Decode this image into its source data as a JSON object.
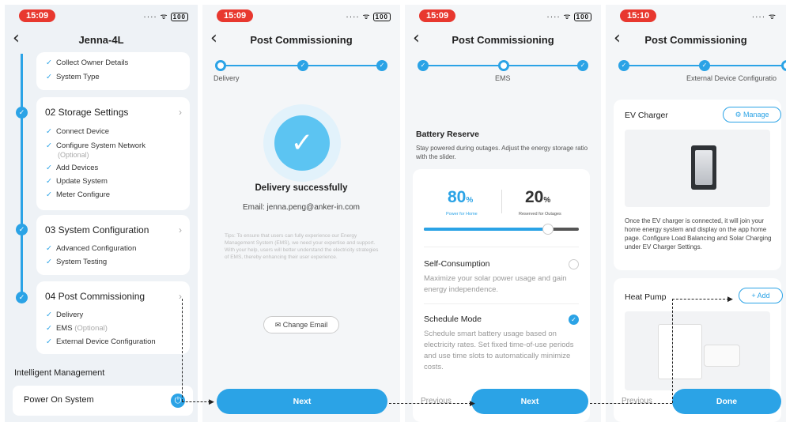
{
  "screen1": {
    "time": "15:09",
    "battery": "100",
    "title": "Jenna-4L",
    "card0_items": [
      "Collect Owner Details",
      "System Type"
    ],
    "card1": {
      "title": "02 Storage Settings",
      "items": [
        "Connect Device",
        "Configure System Network",
        "Add Devices",
        "Update System",
        "Meter Configure"
      ],
      "optional_note": "(Optional)"
    },
    "card2": {
      "title": "03 System Configuration",
      "items": [
        "Advanced Configuration",
        "System Testing"
      ]
    },
    "card3": {
      "title": "04 Post Commissioning",
      "items": [
        "Delivery",
        "EMS",
        "External Device Configuration"
      ],
      "ems_optional": "(Optional)"
    },
    "section_label": "Intelligent Management",
    "power_label": "Power On System"
  },
  "screen2": {
    "time": "15:09",
    "battery": "100",
    "title": "Post Commissioning",
    "step_label": "Delivery",
    "success_title": "Delivery successfully",
    "email": "Email: jenna.peng@anker-in.com",
    "tips": "Tips: To ensure that users can fully experience our Energy Management System (EMS), we need your expertise and support. With your help, users will better understand the electricity strategies of EMS, thereby enhancing their user experience.",
    "change_email": "Change Email",
    "next": "Next"
  },
  "screen3": {
    "time": "15:09",
    "battery": "100",
    "title": "Post Commissioning",
    "step_label": "EMS",
    "heading": "Battery Reserve",
    "desc": "Stay powered during outages. Adjust the energy storage ratio with the slider.",
    "home_pct": "80",
    "home_caption": "Power for Home",
    "reserve_pct": "20",
    "reserve_caption": "Reserved for Outages",
    "pct_sign": "%",
    "slider_fraction": 0.8,
    "option1_title": "Self-Consumption",
    "option1_desc": "Maximize your solar power usage and gain energy independence.",
    "option2_title": "Schedule Mode",
    "option2_desc": "Schedule smart battery usage based on electricity rates. Set fixed time-of-use periods and use time slots to automatically minimize costs.",
    "previous": "Previous",
    "next": "Next"
  },
  "screen4": {
    "time": "15:10",
    "title": "Post Commissioning",
    "step_label": "External Device Configuratio",
    "ev_title": "EV Charger",
    "manage": "Manage",
    "ev_desc": "Once the EV charger is connected, it will join your home energy system and display on the app home page. Configure Load Balancing and Solar Charging under EV Charger Settings.",
    "hp_title": "Heat Pump",
    "add": "Add",
    "previous": "Previous",
    "done": "Done"
  },
  "colors": {
    "accent": "#2ba3e6",
    "status_red": "#e8382f"
  }
}
